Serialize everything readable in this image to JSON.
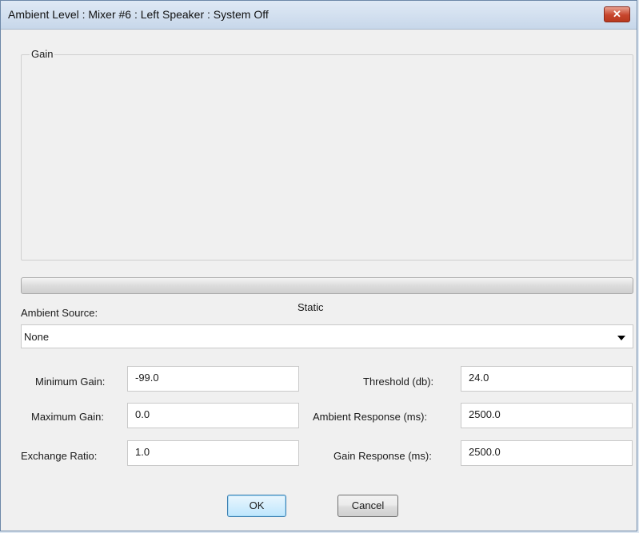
{
  "window": {
    "title": "Ambient Level : Mixer #6 : Left Speaker : System Off",
    "close_glyph": "✕"
  },
  "gain_group": {
    "label": "Gain"
  },
  "ambient_source": {
    "label": "Ambient Source:",
    "selected": "None",
    "status": "Static"
  },
  "fields": {
    "minimum_gain": {
      "label": "Minimum Gain:",
      "value": "-99.0"
    },
    "maximum_gain": {
      "label": "Maximum Gain:",
      "value": "0.0"
    },
    "exchange_ratio": {
      "label": "Exchange Ratio:",
      "value": "1.0"
    },
    "threshold": {
      "label": "Threshold (db):",
      "value": "24.0"
    },
    "ambient_response": {
      "label": "Ambient Response (ms):",
      "value": "2500.0"
    },
    "gain_response": {
      "label": "Gain Response (ms):",
      "value": "2500.0"
    }
  },
  "buttons": {
    "ok": "OK",
    "cancel": "Cancel"
  }
}
